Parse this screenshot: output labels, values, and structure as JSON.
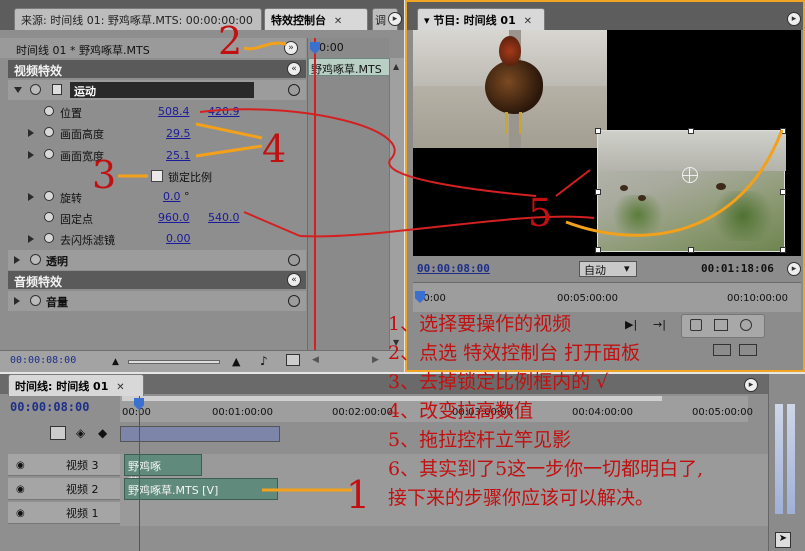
{
  "effect_controls": {
    "tabs": [
      "来源: 时间线 01: 野鸡啄草.MTS: 00:00:00:00",
      "特效控制台",
      "调"
    ],
    "clip_title": "时间线 01 * 野鸡啄草.MTS",
    "mini_timecode": "00:00",
    "mini_clip": "野鸡啄草.MTS",
    "video_effects_label": "视频特效",
    "motion_label": "运动",
    "position_label": "位置",
    "position_x": "508.4",
    "position_y": "420.9",
    "height_label": "画面高度",
    "height_value": "29.5",
    "width_label": "画面宽度",
    "width_value": "25.1",
    "lock_ratio_label": "锁定比例",
    "rotation_label": "旋转",
    "rotation_value": "0.0",
    "rotation_unit": "°",
    "anchor_label": "固定点",
    "anchor_x": "960.0",
    "anchor_y": "540.0",
    "antiflicker_label": "去闪烁滤镜",
    "antiflicker_value": "0.00",
    "opacity_label": "透明",
    "audio_effects_label": "音频特效",
    "volume_label": "音量",
    "bottom_timecode": "00:00:08:00"
  },
  "program_monitor": {
    "title": "节目: 时间线 01",
    "current_timecode": "00:00:08:00",
    "fit_option": "自动",
    "duration": "00:01:18:06",
    "ruler_labels": [
      "00:00",
      "00:05:00:00",
      "00:10:00:00"
    ]
  },
  "timeline": {
    "title": "时间线: 时间线 01",
    "timecode": "00:00:08:00",
    "ruler_labels": [
      "00:00",
      "00:01:00:00",
      "00:02:00:00",
      "00:03:00:00",
      "00:04:00:00",
      "00:05:00:00"
    ],
    "tracks": [
      {
        "label": "视频 3",
        "clip": "野鸡啄草.MTS"
      },
      {
        "label": "视频 2",
        "clip": "野鸡啄草.MTS [V]"
      },
      {
        "label": "视频 1",
        "clip": ""
      }
    ]
  },
  "annotations": {
    "numbers": [
      "1",
      "2",
      "3",
      "4",
      "5"
    ],
    "steps": [
      "1、选择要操作的视频",
      "2、点选 特效控制台 打开面板",
      "3、去掉锁定比例框内的 √",
      "4、改变拉高数值",
      "5、拖拉控杆立竿见影",
      "6、其实到了5这一步你一切都明白了,",
      "接下来的步骤你应该可以解决。"
    ]
  },
  "colors": {
    "annotation_red": "#c21010",
    "arrow_orange": "#f3a11a",
    "value_blue": "#1b1b9a",
    "clip_green": "#5f8a7c"
  }
}
